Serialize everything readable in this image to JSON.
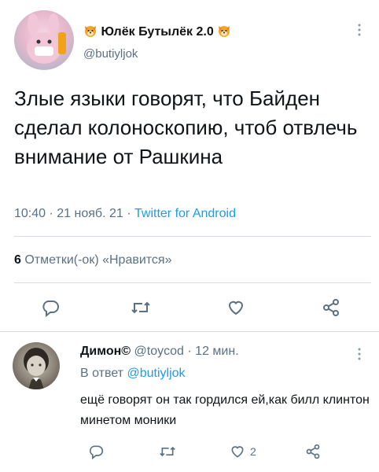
{
  "main_tweet": {
    "author_name": "Юлёк Бутылёк 2.0",
    "name_emoji": "dog-face-emoji",
    "handle": "@butiyljok",
    "text": "Злые языки говорят, что Байден сделал колоноскопию, чтоб отвлечь внимание от Рашкина",
    "time": "10:40",
    "date": "21 нояб. 21",
    "client": "Twitter for Android",
    "separator": "·",
    "likes_count": "6",
    "likes_label": "Отметки(-ок) «Нравится»",
    "more_icon": "more-vertical-icon",
    "actions": [
      "reply-icon",
      "retweet-icon",
      "like-icon",
      "share-icon"
    ]
  },
  "reply_tweet": {
    "author_name": "Димон©",
    "handle": "@toycod",
    "separator": "·",
    "time_ago": "12 мин.",
    "reply_prefix": "В ответ",
    "reply_to": "@butiyljok",
    "text": "ещё говорят он так гордился ей,как билл клинтон минетом моники",
    "like_count": "2",
    "more_icon": "more-vertical-icon",
    "actions": [
      "reply-icon",
      "retweet-icon",
      "like-icon",
      "share-icon"
    ]
  },
  "colors": {
    "link": "#1d9bf0",
    "secondary_text": "#5b7083",
    "divider": "#d5dbe0"
  }
}
